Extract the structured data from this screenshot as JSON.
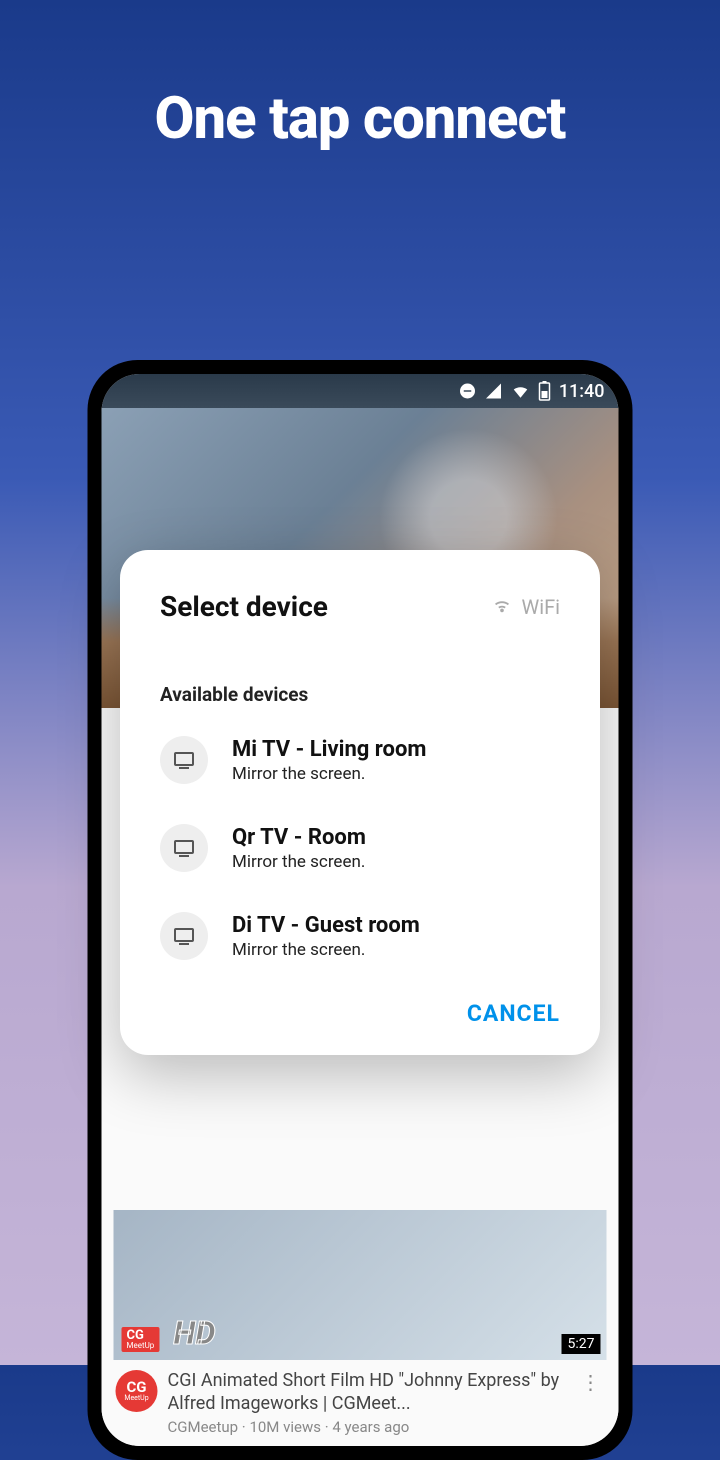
{
  "hero": {
    "title": "One tap connect"
  },
  "status": {
    "time": "11:40"
  },
  "dialog": {
    "title": "Select device",
    "connection": "WiFi",
    "section": "Available devices",
    "devices": [
      {
        "name": "Mi TV - Living room",
        "sub": "Mirror the screen."
      },
      {
        "name": "Qr TV - Room",
        "sub": "Mirror the screen."
      },
      {
        "name": "Di TV - Guest room",
        "sub": "Mirror the screen."
      }
    ],
    "cancel": "CANCEL"
  },
  "video": {
    "duration": "5:27",
    "title": "CGI Animated Short Film HD \"Johnny Express\" by Alfred Imageworks | CGMeet...",
    "meta": "CGMeetup · 10M views · 4 years ago",
    "badge": "CG",
    "badge_sub": "MeetUp"
  }
}
